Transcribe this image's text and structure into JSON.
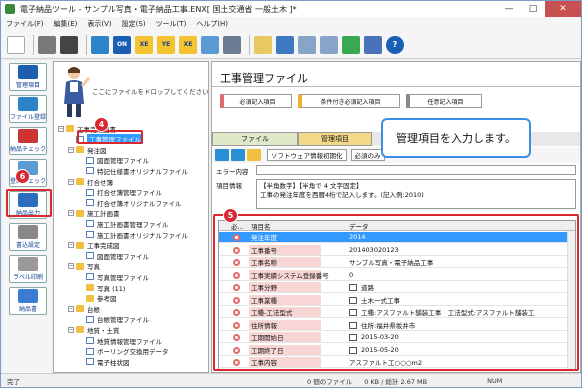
{
  "window": {
    "title": "電子納品ツール - サンプル写真・電子納品工事.ENX[ 国土交通省 一般土木 ]*",
    "controls": [
      "—",
      "□",
      "✕"
    ]
  },
  "menu": [
    "ファイル(F)",
    "編集(E)",
    "表示(V)",
    "設定(S)",
    "ツール(T)",
    "ヘルプ(H)"
  ],
  "toolbar": {
    "icons": [
      "new-icon",
      "open-icon",
      "save-icon",
      "box-icon",
      "on-icon",
      "xe-icon",
      "ye-icon",
      "xe2-icon",
      "scan-icon",
      "pc-icon",
      "tree-icon",
      "list-icon",
      "sheet-icon",
      "sheet2-icon",
      "refresh-icon",
      "help-book-icon",
      "help-icon"
    ]
  },
  "left_buttons": [
    "管理項目",
    "ファイル登録",
    "納品チェック",
    "登録チェック",
    "納品出力",
    "書込設定",
    "ラベル印刷",
    "納品書"
  ],
  "dropzone_text": "ここにファイルをドロップしてください",
  "tree": [
    {
      "label": "工事完成図書",
      "indent": 0,
      "toggle": "−",
      "icon": "folder"
    },
    {
      "label": "工事管理ファイル",
      "indent": 1,
      "toggle": "",
      "icon": "file",
      "selected": true
    },
    {
      "label": "発注図",
      "indent": 1,
      "toggle": "−",
      "icon": "folder"
    },
    {
      "label": "図面管理ファイル",
      "indent": 2,
      "toggle": "",
      "icon": "file"
    },
    {
      "label": "特記仕様書オリジナルファイル",
      "indent": 2,
      "toggle": "",
      "icon": "file"
    },
    {
      "label": "打合せ簿",
      "indent": 1,
      "toggle": "−",
      "icon": "folder"
    },
    {
      "label": "打合せ簿管理ファイル",
      "indent": 2,
      "toggle": "",
      "icon": "file"
    },
    {
      "label": "打合せ簿オリジナルファイル",
      "indent": 2,
      "toggle": "",
      "icon": "file"
    },
    {
      "label": "施工計画書",
      "indent": 1,
      "toggle": "−",
      "icon": "folder"
    },
    {
      "label": "施工計画書管理ファイル",
      "indent": 2,
      "toggle": "",
      "icon": "file"
    },
    {
      "label": "施工計画書オリジナルファイル",
      "indent": 2,
      "toggle": "",
      "icon": "file"
    },
    {
      "label": "工事完成図",
      "indent": 1,
      "toggle": "−",
      "icon": "folder"
    },
    {
      "label": "図面管理ファイル",
      "indent": 2,
      "toggle": "",
      "icon": "file"
    },
    {
      "label": "写真",
      "indent": 1,
      "toggle": "−",
      "icon": "folder"
    },
    {
      "label": "写真管理ファイル",
      "indent": 2,
      "toggle": "",
      "icon": "file"
    },
    {
      "label": "写真 (11)",
      "indent": 2,
      "toggle": "",
      "icon": "folder"
    },
    {
      "label": "参考図",
      "indent": 2,
      "toggle": "",
      "icon": "folder"
    },
    {
      "label": "台帳",
      "indent": 1,
      "toggle": "−",
      "icon": "folder"
    },
    {
      "label": "台帳管理ファイル",
      "indent": 2,
      "toggle": "",
      "icon": "file"
    },
    {
      "label": "地質・土質",
      "indent": 1,
      "toggle": "−",
      "icon": "folder"
    },
    {
      "label": "地質情報管理ファイル",
      "indent": 2,
      "toggle": "",
      "icon": "file"
    },
    {
      "label": "ボーリング交換用データ",
      "indent": 2,
      "toggle": "",
      "icon": "file"
    },
    {
      "label": "電子柱状図",
      "indent": 2,
      "toggle": "",
      "icon": "file"
    }
  ],
  "right": {
    "page_title": "工事管理ファイル",
    "legend": [
      "必須記入項目",
      "条件付き必須記入項目",
      "任意記入項目"
    ],
    "tabs": [
      "ファイル",
      "管理項目"
    ],
    "subtoolbar": {
      "sw_init": "ソフトウェア情報初期化",
      "required_only": "必須のみ"
    },
    "error_label": "エラー内容",
    "info_label": "項目情報",
    "info_text": [
      "【半角数字】【半角で 4 文字固定】",
      "工事の発注年度を西暦4桁で記入します。(記入例:2010)"
    ],
    "grid_headers": {
      "must": "必...",
      "name": "項目名",
      "data": "データ"
    },
    "rows": [
      {
        "name": "発注年度",
        "value": "2014",
        "cal": false,
        "highlight": true
      },
      {
        "name": "工事番号",
        "value": "201403020123",
        "cal": false,
        "highlight": false
      },
      {
        "name": "工事名称",
        "value": "サンプル写真・電子納品工事",
        "cal": false,
        "highlight": false
      },
      {
        "name": "工事実績システム登録番号",
        "value": "0",
        "cal": false,
        "highlight": false
      },
      {
        "name": "工事分野",
        "value": "道路",
        "cal": true,
        "highlight": false
      },
      {
        "name": "工事業種",
        "value": "土木一式工事",
        "cal": true,
        "highlight": false
      },
      {
        "name": "工種-工法型式",
        "value": "工種:アスファルト舗装工事　工法型式:アスファルト舗装工",
        "cal": true,
        "highlight": false
      },
      {
        "name": "住所情報",
        "value": "住所:福井県坂井市",
        "cal": true,
        "highlight": false
      },
      {
        "name": "工期開始日",
        "value": "2015-03-20",
        "cal": true,
        "highlight": false
      },
      {
        "name": "工期終了日",
        "value": "2015-05-20",
        "cal": true,
        "highlight": false
      },
      {
        "name": "工事内容",
        "value": "アスファルト工○○○m2",
        "cal": false,
        "highlight": false
      }
    ]
  },
  "callout_text": "管理項目を入力します。",
  "markers": [
    "4",
    "5",
    "6"
  ],
  "status": {
    "left": "完了",
    "mid": "0 個のファイル",
    "size": "0 KB / 総計 2.67 MB",
    "num": "NUM"
  }
}
